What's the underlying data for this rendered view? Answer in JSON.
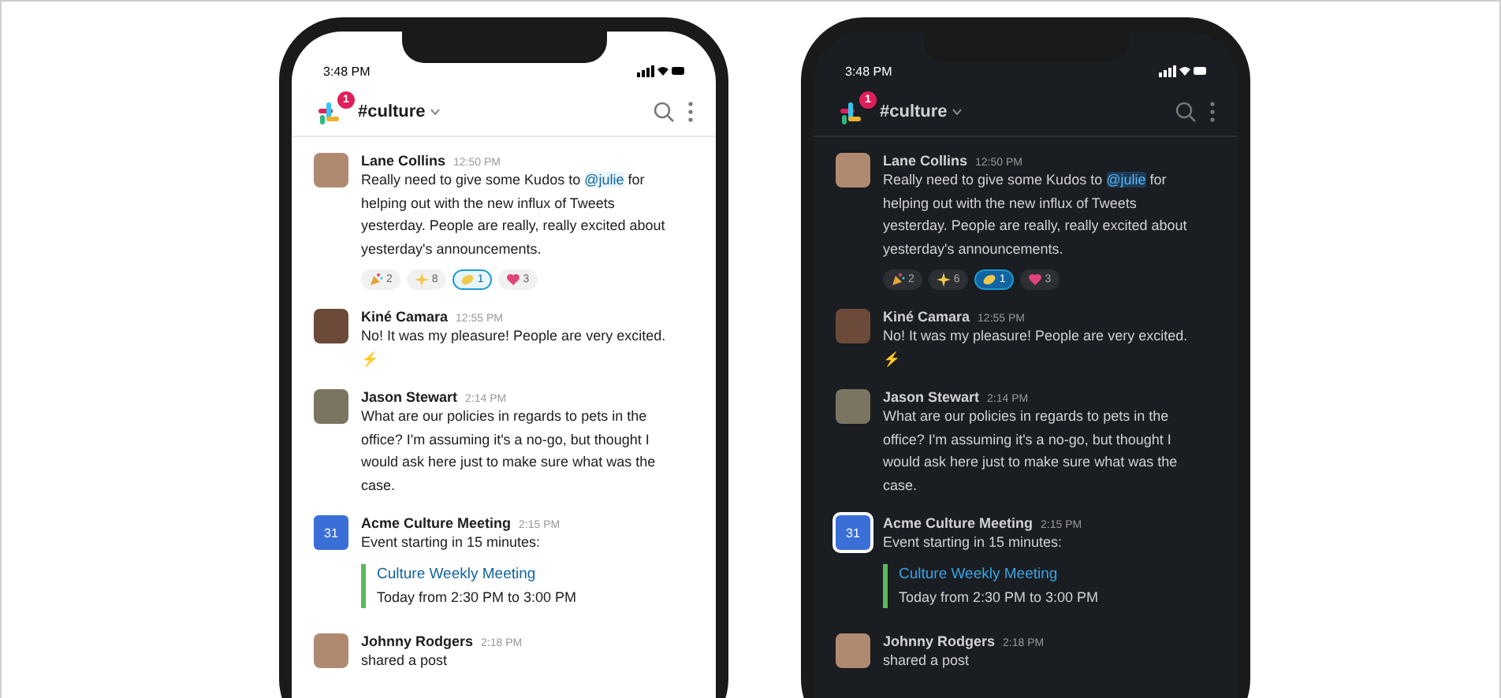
{
  "phones": [
    {
      "dark": false,
      "time": "3:48 PM",
      "badge": "1",
      "channel": "#culture",
      "messages": [
        {
          "kind": "user",
          "name": "Lane Collins",
          "time": "12:50 PM",
          "text_before": "Really need to give some Kudos to ",
          "mention": "@julie",
          "text_after": " for helping out with the new influx of Tweets yesterday. People are really, really excited about yesterday's announcements.",
          "reactions": [
            {
              "count": "2",
              "selected": false
            },
            {
              "count": "8",
              "selected": false
            },
            {
              "count": "1",
              "selected": true
            },
            {
              "count": "3",
              "selected": false
            }
          ]
        },
        {
          "kind": "user",
          "name": "Kiné Camara",
          "time": "12:55 PM",
          "text_before": "No! It was my pleasure! People are very excited. ⚡"
        },
        {
          "kind": "user",
          "name": "Jason Stewart",
          "time": "2:14 PM",
          "text_before": "What are our policies in regards to pets in the office? I'm assuming it's a no-go, but thought I would ask here just to make sure what was the case."
        },
        {
          "kind": "event",
          "name": "Acme Culture Meeting",
          "time": "2:15 PM",
          "day": "31",
          "text_before": "Event starting in 15 minutes:",
          "event_title": "Culture Weekly Meeting",
          "event_time": "Today from 2:30 PM to 3:00 PM"
        },
        {
          "kind": "user",
          "name": "Johnny Rodgers",
          "time": "2:18 PM",
          "text_before": "shared a post"
        }
      ]
    },
    {
      "dark": true,
      "time": "3:48 PM",
      "badge": "1",
      "channel": "#culture",
      "messages": [
        {
          "kind": "user",
          "name": "Lane Collins",
          "time": "12:50 PM",
          "text_before": "Really need to give some Kudos to ",
          "mention": "@julie",
          "text_after": " for helping out with the new influx of Tweets yesterday. People are really, really excited about yesterday's announcements.",
          "reactions": [
            {
              "count": "2",
              "selected": false
            },
            {
              "count": "6",
              "selected": false
            },
            {
              "count": "1",
              "selected": true
            },
            {
              "count": "3",
              "selected": false
            }
          ]
        },
        {
          "kind": "user",
          "name": "Kiné Camara",
          "time": "12:55 PM",
          "text_before": "No! It was my pleasure! People are very excited. ⚡"
        },
        {
          "kind": "user",
          "name": "Jason Stewart",
          "time": "2:14 PM",
          "text_before": "What are our policies in regards to pets in the office? I'm assuming it's a no-go, but thought I would ask here just to make sure what was the case."
        },
        {
          "kind": "event",
          "name": "Acme Culture Meeting",
          "time": "2:15 PM",
          "day": "31",
          "text_before": "Event starting in 15 minutes:",
          "event_title": "Culture Weekly Meeting",
          "event_time": "Today from 2:30 PM to 3:00 PM"
        },
        {
          "kind": "user",
          "name": "Johnny Rodgers",
          "time": "2:18 PM",
          "text_before": "shared a post"
        }
      ]
    }
  ]
}
